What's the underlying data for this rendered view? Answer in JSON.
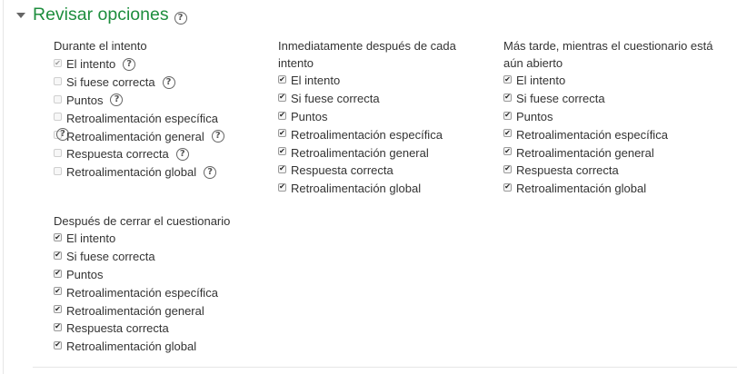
{
  "section": {
    "title": "Revisar opciones",
    "help_icon": "question-circle-icon",
    "expanded": true
  },
  "groups": [
    {
      "id": "during",
      "title": "Durante el intento",
      "options": [
        {
          "label": "El intento",
          "checked": true,
          "disabled": true,
          "help": true
        },
        {
          "label": "Si fuese correcta",
          "checked": false,
          "disabled": true,
          "help": true
        },
        {
          "label": "Puntos",
          "checked": false,
          "disabled": true,
          "help": true
        },
        {
          "label": "Retroalimentación específica",
          "checked": false,
          "disabled": true,
          "help": false
        },
        {
          "label": "Retroalimentación general",
          "checked": false,
          "disabled": true,
          "help": true
        },
        {
          "label": "Respuesta correcta",
          "checked": false,
          "disabled": true,
          "help": true
        },
        {
          "label": "Retroalimentación global",
          "checked": false,
          "disabled": true,
          "help": true
        }
      ]
    },
    {
      "id": "immediately",
      "title_line1": "Inmediatamente después de cada",
      "title_line2": "intento",
      "options": [
        {
          "label": "El intento",
          "checked": true,
          "disabled": false
        },
        {
          "label": "Si fuese correcta",
          "checked": true,
          "disabled": false
        },
        {
          "label": "Puntos",
          "checked": true,
          "disabled": false
        },
        {
          "label": "Retroalimentación específica",
          "checked": true,
          "disabled": false
        },
        {
          "label": "Retroalimentación general",
          "checked": true,
          "disabled": false
        },
        {
          "label": "Respuesta correcta",
          "checked": true,
          "disabled": false
        },
        {
          "label": "Retroalimentación global",
          "checked": true,
          "disabled": false
        }
      ]
    },
    {
      "id": "later",
      "title_line1": "Más tarde, mientras el cuestionario está",
      "title_line2": "aún abierto",
      "options": [
        {
          "label": "El intento",
          "checked": true,
          "disabled": false
        },
        {
          "label": "Si fuese correcta",
          "checked": true,
          "disabled": false
        },
        {
          "label": "Puntos",
          "checked": true,
          "disabled": false
        },
        {
          "label": "Retroalimentación específica",
          "checked": true,
          "disabled": false
        },
        {
          "label": "Retroalimentación general",
          "checked": true,
          "disabled": false
        },
        {
          "label": "Respuesta correcta",
          "checked": true,
          "disabled": false
        },
        {
          "label": "Retroalimentación global",
          "checked": true,
          "disabled": false
        }
      ]
    },
    {
      "id": "after",
      "title": "Después de cerrar el cuestionario",
      "options": [
        {
          "label": "El intento",
          "checked": true,
          "disabled": false
        },
        {
          "label": "Si fuese correcta",
          "checked": true,
          "disabled": false
        },
        {
          "label": "Puntos",
          "checked": true,
          "disabled": false
        },
        {
          "label": "Retroalimentación específica",
          "checked": true,
          "disabled": false
        },
        {
          "label": "Retroalimentación general",
          "checked": true,
          "disabled": false
        },
        {
          "label": "Respuesta correcta",
          "checked": true,
          "disabled": false
        },
        {
          "label": "Retroalimentación global",
          "checked": true,
          "disabled": false
        }
      ]
    }
  ]
}
